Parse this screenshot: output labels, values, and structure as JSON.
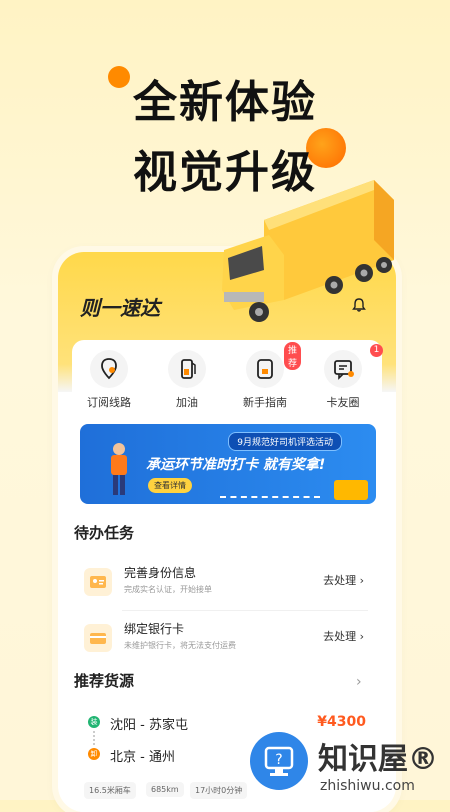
{
  "promo": {
    "line1": "全新体验",
    "line2": "视觉升级"
  },
  "app": {
    "title": "则一速达"
  },
  "quick_actions": [
    {
      "label": "订阅线路",
      "icon": "location-pin-icon"
    },
    {
      "label": "加油",
      "icon": "fuel-icon"
    },
    {
      "label": "新手指南",
      "icon": "guide-icon",
      "badge": "推荐"
    },
    {
      "label": "卡友圈",
      "icon": "chat-icon",
      "badge": "1"
    }
  ],
  "banner": {
    "tag": "9月规范好司机评选活动",
    "slogan": "承运环节准时打卡 就有奖拿!",
    "cta": "查看详情"
  },
  "todo": {
    "title": "待办任务",
    "items": [
      {
        "title": "完善身份信息",
        "desc": "完成实名认证，开始接单",
        "action": "去处理"
      },
      {
        "title": "绑定银行卡",
        "desc": "未维护银行卡，将无法支付运费",
        "action": "去处理"
      }
    ]
  },
  "recommend": {
    "title": "推荐货源",
    "cargo": {
      "from_tag": "装",
      "from": "沈阳 - 苏家屯",
      "to_tag": "卸",
      "to": "北京 - 通州",
      "price": "¥4300",
      "chips": [
        "16.5米厢车",
        "685km",
        "17小时0分钟"
      ]
    }
  },
  "watermark": {
    "cn": "知识屋®",
    "en": "zhishiwu.com"
  },
  "colors": {
    "accent": "#FFD84A",
    "price": "#FF5A1F",
    "badge": "#FF4D4F"
  }
}
